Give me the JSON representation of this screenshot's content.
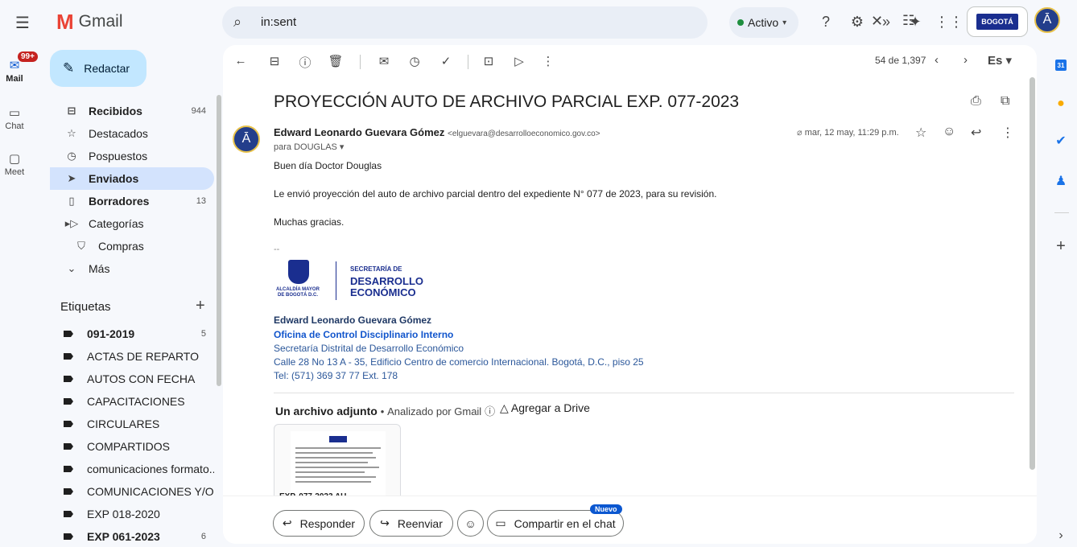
{
  "app": {
    "name": "Gmail"
  },
  "search": {
    "value": "in:sent"
  },
  "status": {
    "label": "Activo",
    "color": "#1e8e3e"
  },
  "org": {
    "logo_text": "BOGOTÁ"
  },
  "rail": {
    "mail": {
      "label": "Mail",
      "badge": "99+"
    },
    "chat": {
      "label": "Chat"
    },
    "meet": {
      "label": "Meet"
    }
  },
  "compose": {
    "label": "Redactar"
  },
  "nav": [
    {
      "label": "Recibidos",
      "count": "944",
      "icon": "inbox-icon",
      "bold": true
    },
    {
      "label": "Destacados",
      "count": "",
      "icon": "star-icon",
      "bold": false
    },
    {
      "label": "Pospuestos",
      "count": "",
      "icon": "clock-icon",
      "bold": false
    },
    {
      "label": "Enviados",
      "count": "",
      "icon": "send-icon",
      "bold": true,
      "active": true
    },
    {
      "label": "Borradores",
      "count": "13",
      "icon": "file-icon",
      "bold": true
    },
    {
      "label": "Categorías",
      "count": "",
      "icon": "label-icon",
      "bold": false
    },
    {
      "label": "Compras",
      "count": "",
      "icon": "shopping-bag-icon",
      "bold": false,
      "sub": true
    },
    {
      "label": "Más",
      "count": "",
      "icon": "chevron-down-icon",
      "bold": false
    }
  ],
  "labels": {
    "title": "Etiquetas",
    "items": [
      {
        "label": "091-2019",
        "count": "5",
        "bold": true
      },
      {
        "label": "ACTAS DE REPARTO",
        "count": "",
        "bold": false
      },
      {
        "label": "AUTOS CON FECHA",
        "count": "",
        "bold": false
      },
      {
        "label": "CAPACITACIONES",
        "count": "",
        "bold": false
      },
      {
        "label": "CIRCULARES",
        "count": "",
        "bold": false
      },
      {
        "label": "COMPARTIDOS",
        "count": "",
        "bold": false
      },
      {
        "label": "comunicaciones formato...",
        "count": "",
        "bold": false
      },
      {
        "label": "COMUNICACIONES Y/O ...",
        "count": "",
        "bold": false
      },
      {
        "label": "EXP 018-2020",
        "count": "",
        "bold": false
      },
      {
        "label": "EXP 061-2023",
        "count": "6",
        "bold": true
      }
    ]
  },
  "toolbar": {
    "pager": "54 de 1,397",
    "language": "Es"
  },
  "message": {
    "subject": "PROYECCIÓN AUTO DE ARCHIVO PARCIAL EXP. 077-2023",
    "sender_name": "Edward Leonardo Guevara Gómez",
    "sender_email": "<elguevara@desarrolloeconomico.gov.co>",
    "recipient": "para DOUGLAS",
    "date": "mar, 12 may, 11:29 p.m.",
    "greeting": "Buen día Doctor Douglas",
    "body": "Le envió proyección del auto de archivo parcial dentro del expediente N° 077 de 2023, para su revisión.",
    "closing": "Muchas gracias.",
    "signature_dash": "--"
  },
  "signature": {
    "alcaldia": "ALCALDÍA MAYOR DE BOGOTÁ D.C.",
    "secretaria": "SECRETARÍA DE",
    "desarrollo": "DESARROLLO",
    "economico": "ECONÓMICO",
    "name": "Edward Leonardo Guevara Gómez",
    "office": "Oficina de Control Disciplinario Interno",
    "entity": "Secretaría Distrital de Desarrollo Económico",
    "address": "Calle 28 No 13 A - 35, Edificio Centro de comercio Internacional. Bogotá, D.C., piso 25",
    "phone": "Tel: (571) 369 37 77 Ext. 178"
  },
  "attachments": {
    "heading": "Un archivo adjunto",
    "separator": "•",
    "scanned": "Analizado por Gmail",
    "drive": "Agregar a Drive",
    "file_name": "EXP. 077-2023 AU..."
  },
  "actions": {
    "reply": "Responder",
    "forward": "Reenviar",
    "share_chat": "Compartir en el chat",
    "new_badge": "Nuevo"
  },
  "colors": {
    "accent": "#0b57d0",
    "compose_bg": "#c2e7ff",
    "active_nav": "#d3e3fd",
    "badge": "#c5221f"
  }
}
